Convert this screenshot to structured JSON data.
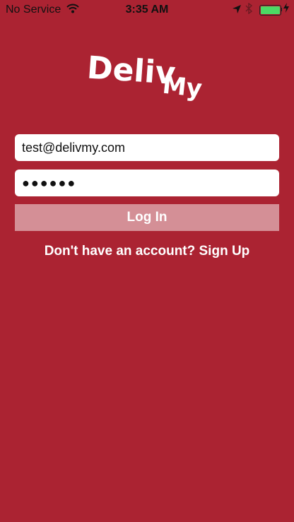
{
  "status_bar": {
    "carrier": "No Service",
    "time": "3:35 AM",
    "battery_level": 1.0,
    "battery_color": "#4cd964"
  },
  "logo": {
    "part1": "Deliv",
    "part2": "My"
  },
  "form": {
    "email_value": "test@delivmy.com",
    "password_mask": "●●●●●●",
    "login_label": "Log In",
    "signup_label": "Don't have an account? Sign Up"
  },
  "colors": {
    "background": "#ab2332",
    "button": "#d48f96"
  }
}
